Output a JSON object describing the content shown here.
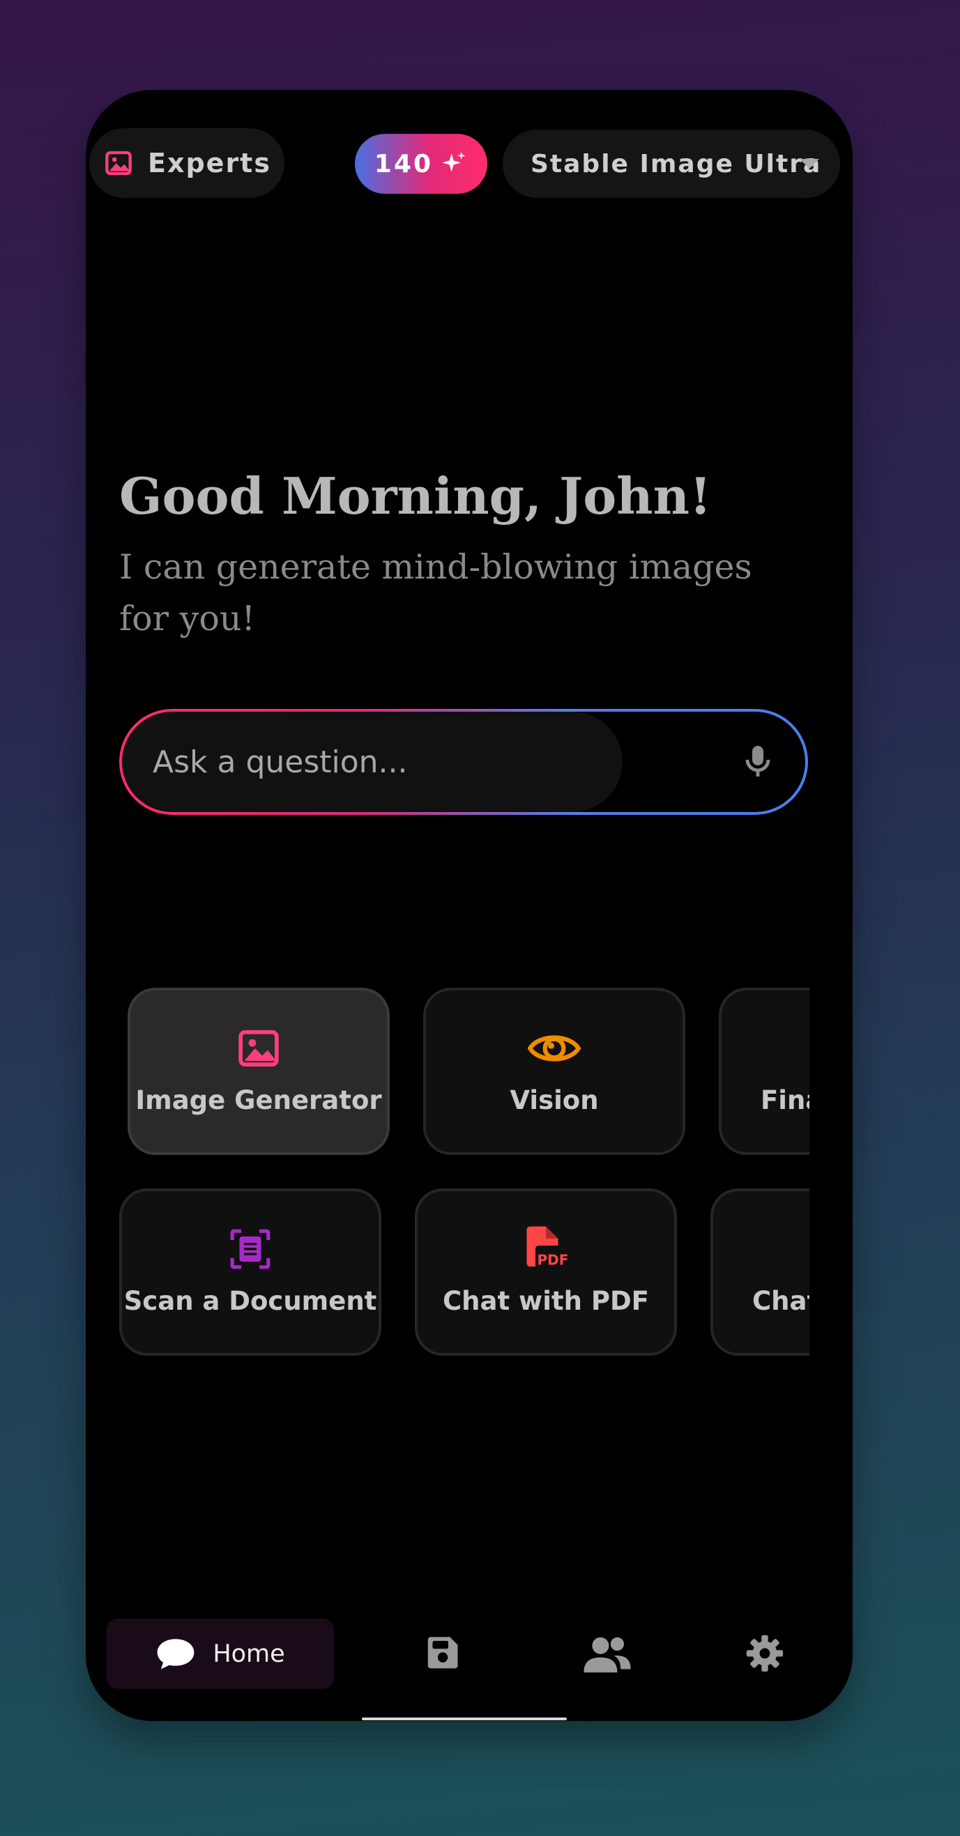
{
  "header": {
    "experts_label": "Experts",
    "credits": "140",
    "model_selected": "Stable Image Ultra"
  },
  "greeting": {
    "title": "Good Morning, John!",
    "subtitle_line1": "I can generate mind-blowing images",
    "subtitle_line2": "for you!"
  },
  "search": {
    "placeholder": "Ask a question..."
  },
  "cards_row1": [
    {
      "label": "Image Generator",
      "icon": "image-icon",
      "color": "#ff3d7f"
    },
    {
      "label": "Vision",
      "icon": "eye-icon",
      "color": "#f08c00"
    },
    {
      "label": "Fina",
      "icon": "unknown"
    }
  ],
  "cards_row2": [
    {
      "label": "Scan a Document",
      "icon": "document-scan-icon",
      "color": "#a729c9"
    },
    {
      "label": "Chat with PDF",
      "icon": "pdf-file-icon",
      "color": "#ff4545"
    },
    {
      "label": "Chat",
      "icon": "unknown"
    }
  ],
  "nav": {
    "home_label": "Home",
    "items": [
      "chat-bubble-icon",
      "save-icon",
      "users-icon",
      "gear-icon"
    ]
  },
  "colors": {
    "accent_pink": "#ff2d6a",
    "accent_blue": "#4a7ef0"
  }
}
